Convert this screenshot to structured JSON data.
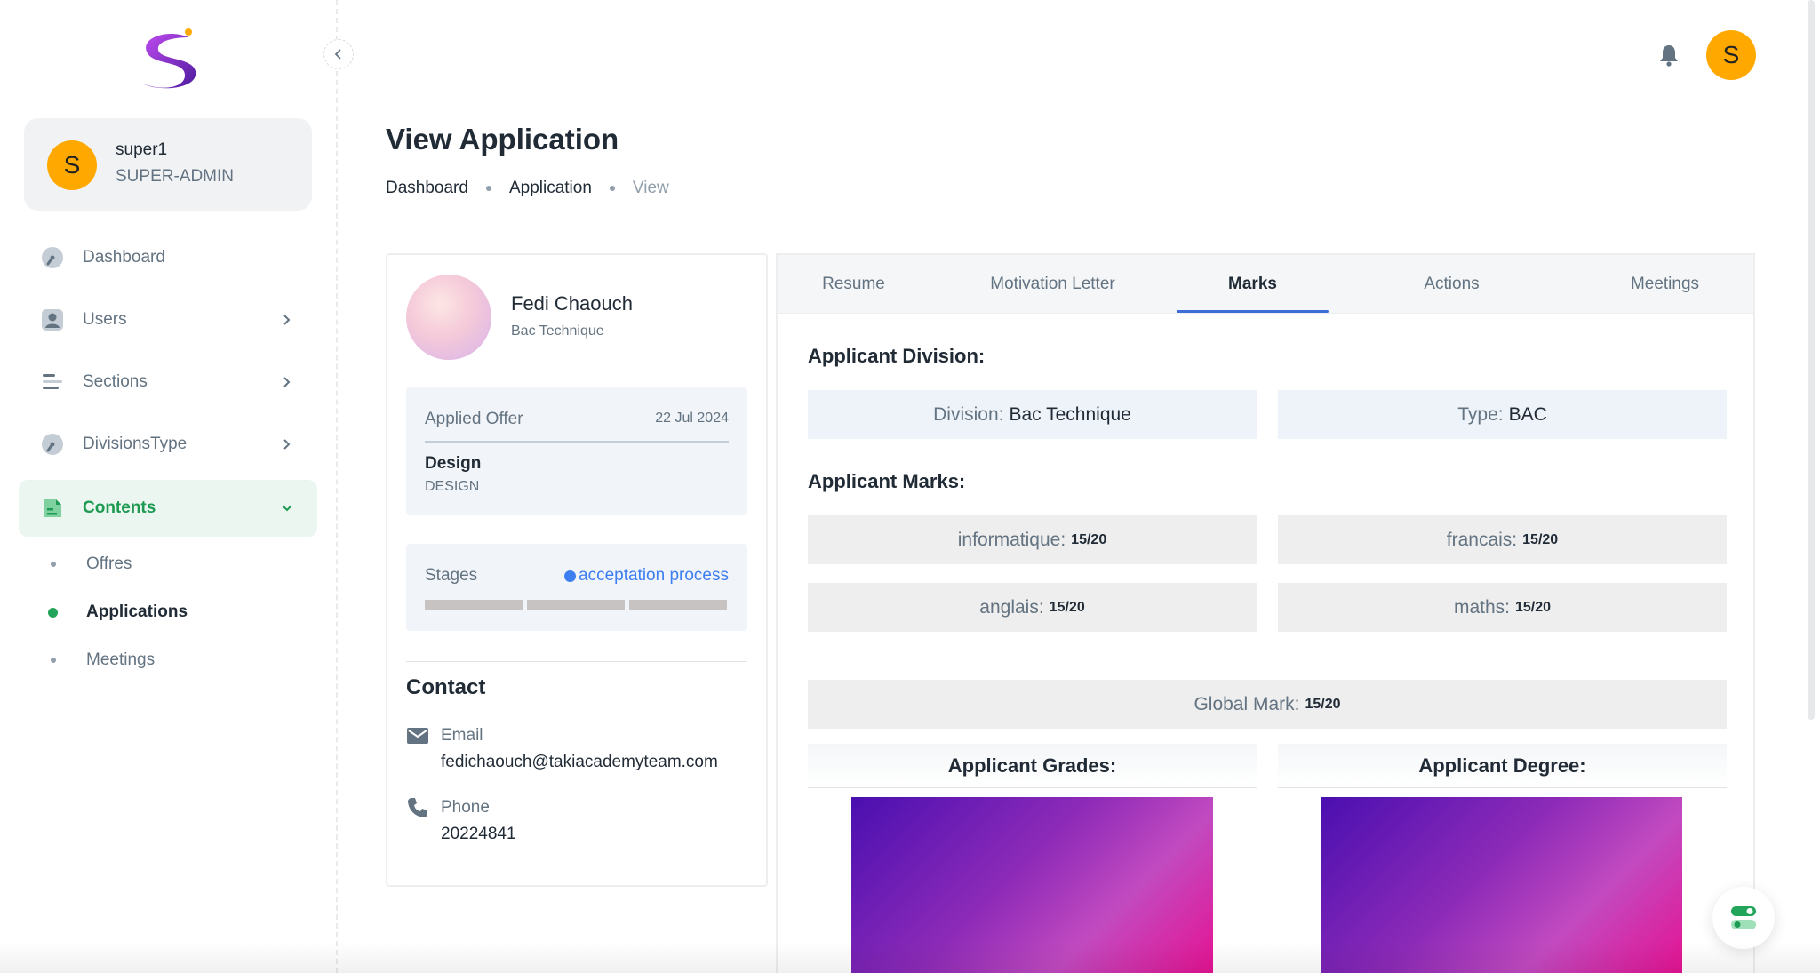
{
  "sidebar": {
    "account": {
      "initial": "S",
      "name": "super1",
      "role": "SUPER-ADMIN"
    },
    "nav": [
      {
        "label": "Dashboard",
        "icon": "dashboard-icon"
      },
      {
        "label": "Users",
        "icon": "user-icon"
      },
      {
        "label": "Sections",
        "icon": "sections-icon"
      },
      {
        "label": "DivisionsType",
        "icon": "divisions-icon"
      },
      {
        "label": "Contents",
        "icon": "contents-icon"
      }
    ],
    "sub_items": [
      {
        "label": "Offres"
      },
      {
        "label": "Applications"
      },
      {
        "label": "Meetings"
      }
    ]
  },
  "header": {
    "avatar_initial": "S"
  },
  "page": {
    "title": "View Application",
    "breadcrumb": [
      "Dashboard",
      "Application",
      "View"
    ]
  },
  "profile": {
    "name": "Fedi Chaouch",
    "subtitle": "Bac Technique",
    "offer": {
      "label": "Applied Offer",
      "date": "22 Jul 2024",
      "title": "Design",
      "code": "DESIGN"
    },
    "stages": {
      "label": "Stages",
      "status": "acceptation process",
      "status_color": "#3d7ef0"
    },
    "contact": {
      "title": "Contact",
      "email_label": "Email",
      "email": "fedichaouch@takiacademyteam.com",
      "phone_label": "Phone",
      "phone": "20224841"
    }
  },
  "tabs": [
    "Resume",
    "Motivation Letter",
    "Marks",
    "Actions",
    "Meetings"
  ],
  "marks": {
    "division_title": "Applicant Division:",
    "division_label": "Division:",
    "division_value": "Bac Technique",
    "type_label": "Type:",
    "type_value": "BAC",
    "marks_title": "Applicant Marks:",
    "subjects": [
      {
        "label": "informatique:",
        "value": "15/20"
      },
      {
        "label": "francais:",
        "value": "15/20"
      },
      {
        "label": "anglais:",
        "value": "15/20"
      },
      {
        "label": "maths:",
        "value": "15/20"
      }
    ],
    "global_label": "Global Mark:",
    "global_value": "15/20",
    "grades_title": "Applicant Grades:",
    "degree_title": "Applicant Degree:"
  },
  "colors": {
    "accent_green": "#22a55a",
    "avatar": "#ffa800",
    "tab_indicator": "#3d6dd9"
  }
}
